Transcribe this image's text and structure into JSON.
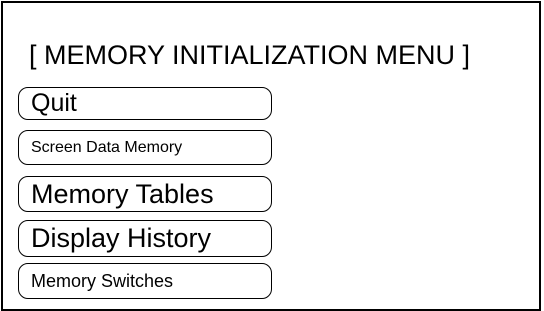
{
  "menu": {
    "title": "[ MEMORY INITIALIZATION MENU ]",
    "items": [
      {
        "label": "Quit"
      },
      {
        "label": "Screen Data Memory"
      },
      {
        "label": "Memory Tables"
      },
      {
        "label": "Display History"
      },
      {
        "label": "Memory Switches"
      }
    ]
  }
}
